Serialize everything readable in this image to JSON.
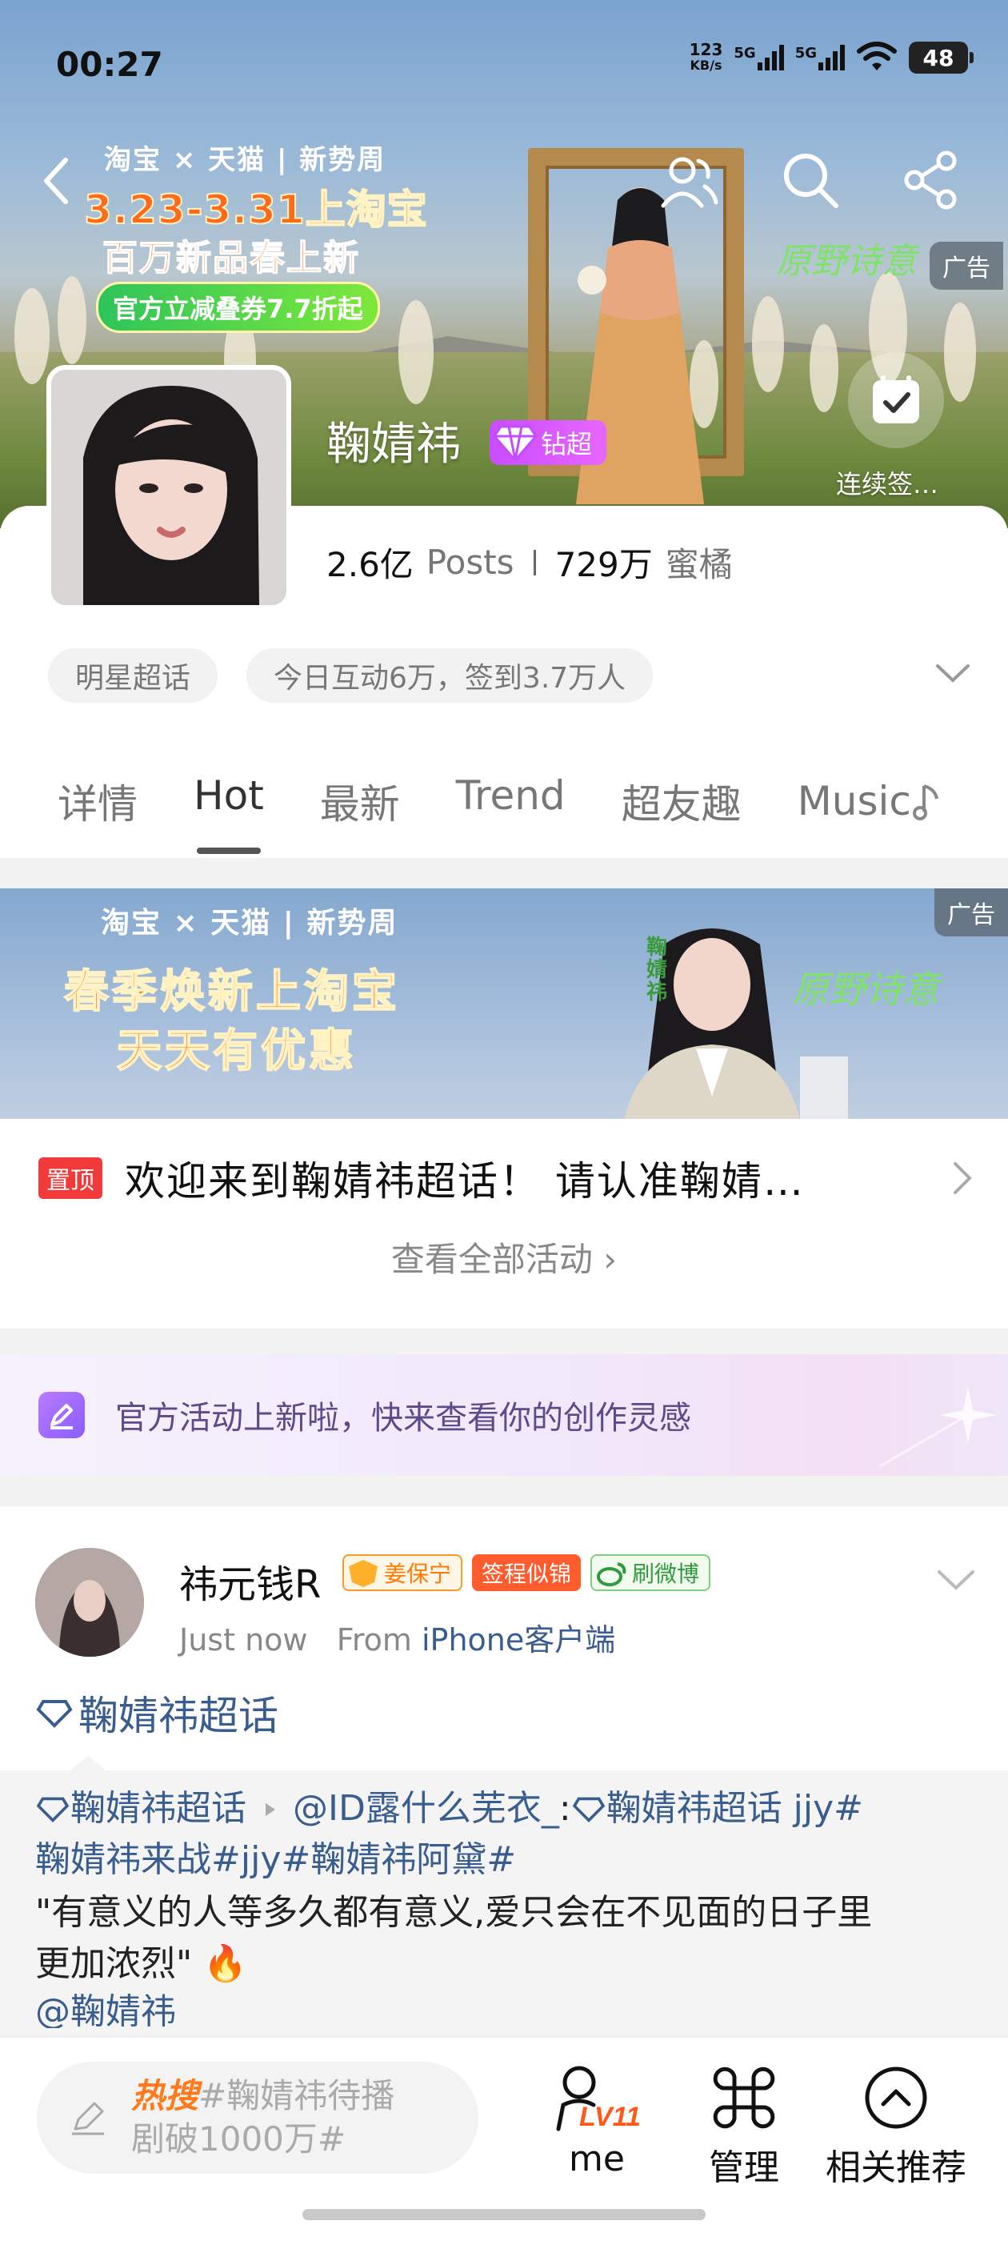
{
  "status_bar": {
    "time": "00:27",
    "net_speed_value": "123",
    "net_speed_unit": "KB/s",
    "signal_1": "5G",
    "signal_2": "5G",
    "battery": "48"
  },
  "hero_ad": {
    "brands": "淘宝 × 天猫 | 新势周",
    "date_line": "3.23-3.31上淘宝",
    "subtitle": "百万新品春上新",
    "coupon": "官方立减叠券7.7折起",
    "slogan": "原野诗意",
    "ad_tag": "广告"
  },
  "profile": {
    "name": "鞠婧祎",
    "badge": "钻超",
    "posts_value": "2.6亿",
    "posts_label": "Posts",
    "fans_value": "729万",
    "fans_label": "蜜橘",
    "checkin_label": "连续签…"
  },
  "chips": [
    "明星超话",
    "今日互动6万，签到3.7万人"
  ],
  "tabs": [
    "详情",
    "Hot",
    "最新",
    "Trend",
    "超友趣",
    "Music"
  ],
  "active_tab": "Hot",
  "ad2": {
    "brands": "淘宝 × 天猫 | 新势周",
    "line1": "春季焕新上淘宝",
    "line2": "天天有优惠",
    "slogan": "原野诗意",
    "ad_tag": "广告",
    "vertical_name": "鞠婧祎"
  },
  "pinned": {
    "badge": "置顶",
    "text": "欢迎来到鞠婧祎超话！  请认准鞠婧…"
  },
  "view_all": "查看全部活动 ›",
  "activity_banner": "官方活动上新啦，快来查看你的创作灵感",
  "post": {
    "author": "祎元钱R",
    "badge_level": "姜保宁",
    "badge_sign": "签程似锦",
    "badge_weibo": "刷微博",
    "time": "Just now",
    "from_label": "From",
    "source": "iPhone客户端",
    "topic": "鞠婧祎超话",
    "repost_line1_topic": "鞠婧祎超话",
    "repost_line1_user": "@ID露什么芜衣_",
    "repost_line1_rest": ":",
    "repost_line1_topic2": "鞠婧祎超话",
    "repost_line1_tail": "  jjy#",
    "repost_line2": "鞠婧祎来战#jjy#鞠婧祎阿黛#",
    "repost_line3": "\"有意义的人等多久都有意义,爱只会在不见面的日子里",
    "repost_line4": "更加浓烈\" 🔥",
    "repost_line5": "@鞠婧祎"
  },
  "bottom_bar": {
    "hot_label": "热搜",
    "search_line1": "#鞠婧祎待播",
    "search_line2": "剧破1000万#",
    "level_badge": "LV11",
    "me": "me",
    "manage": "管理",
    "recommend": "相关推荐"
  },
  "colors": {
    "accent_blue": "#3a5d8f",
    "hot_orange": "#ff7a1a",
    "pin_red": "#f23a3a",
    "badge_purple": "#d65cff"
  }
}
